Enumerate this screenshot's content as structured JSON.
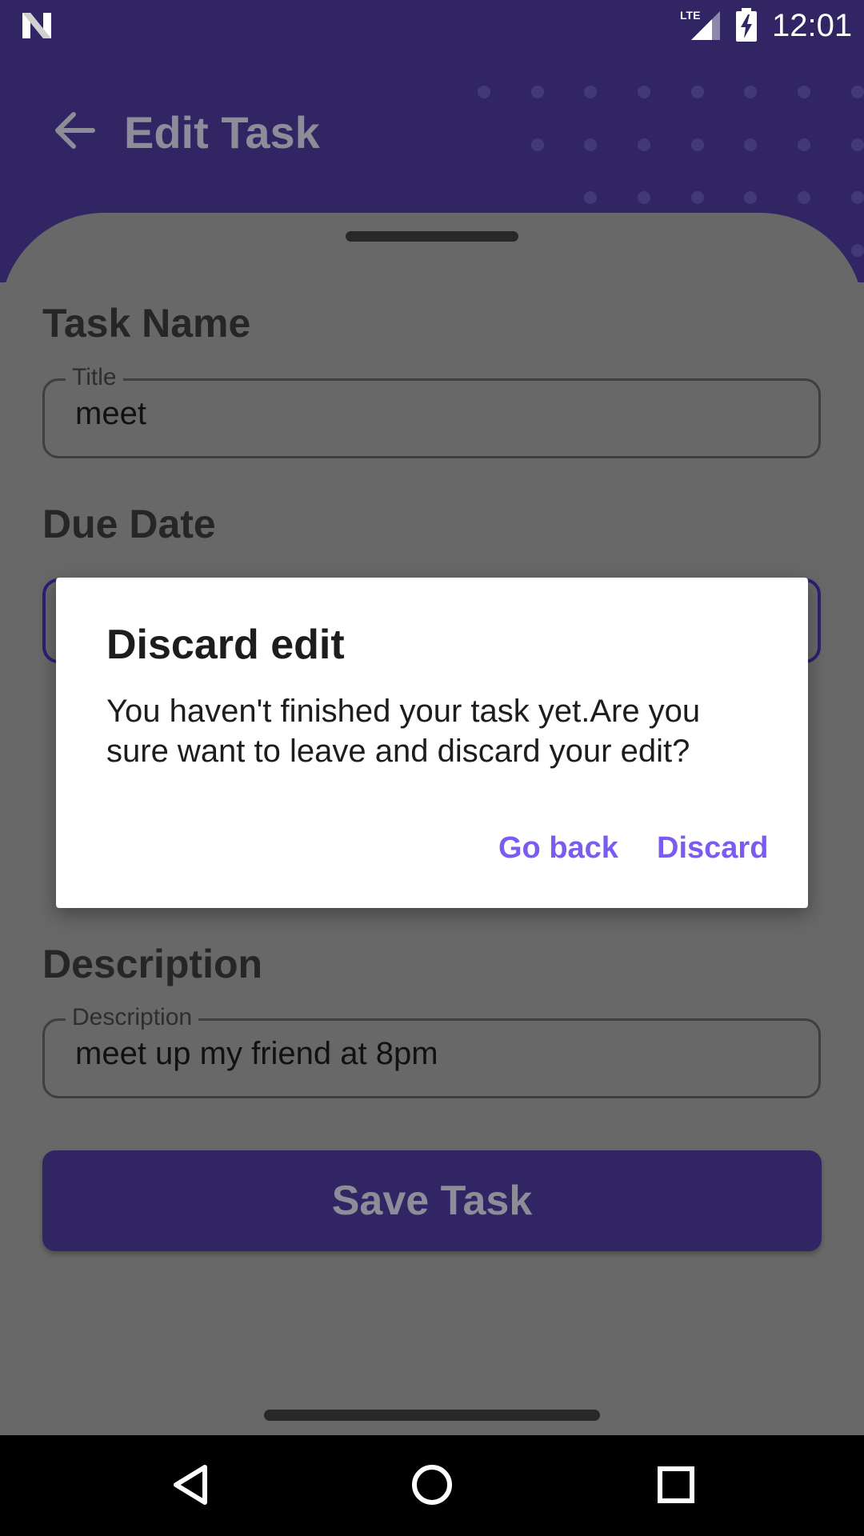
{
  "status_bar": {
    "time": "12:01",
    "network": "LTE",
    "icons": [
      "n-logo-icon",
      "lte-signal-icon",
      "battery-charging-icon"
    ]
  },
  "header": {
    "title": "Edit Task",
    "back_icon": "arrow-left-icon"
  },
  "form": {
    "task_name_label": "Task Name",
    "title_field": {
      "legend": "Title",
      "value": "meet"
    },
    "due_date_label": "Due Date",
    "description_label": "Description",
    "description_field": {
      "legend": "Description",
      "value": "meet up my friend at 8pm"
    },
    "save_button": "Save Task"
  },
  "dialog": {
    "title": "Discard edit",
    "message": "You haven't finished your task yet.Are you sure want to leave and discard your edit?",
    "go_back": "Go back",
    "discard": "Discard"
  },
  "nav_bar": {
    "icons": [
      "nav-back-icon",
      "nav-home-icon",
      "nav-recents-icon"
    ]
  },
  "colors": {
    "primary": "#312564",
    "scrim_background": "#686868",
    "dialog_button": "#7c5cf0"
  }
}
